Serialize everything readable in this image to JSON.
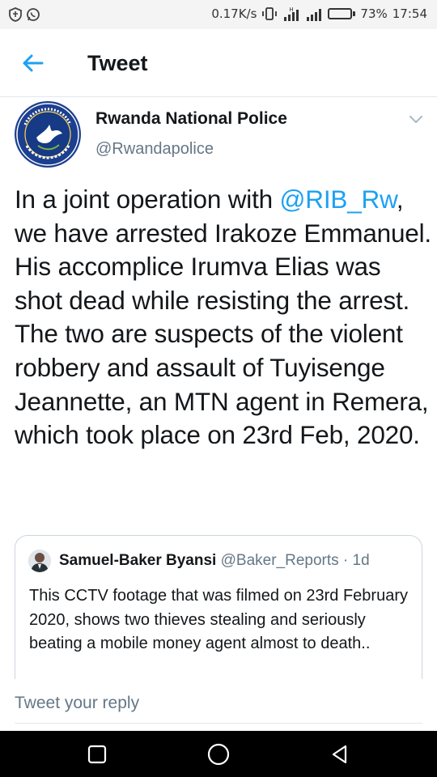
{
  "status_bar": {
    "network_speed": "0.17K/s",
    "battery_percent_text": "73%",
    "battery_level": 0.73,
    "time": "17:54",
    "icons": [
      "shield-icon",
      "whatsapp-icon",
      "vibrate-icon",
      "signal-h-icon",
      "signal-icon",
      "battery-icon"
    ]
  },
  "header": {
    "title": "Tweet",
    "back_icon": "back-arrow-icon"
  },
  "tweet": {
    "author_name": "Rwanda National Police",
    "author_handle": "@Rwandapolice",
    "avatar_icon": "police-logo",
    "menu_icon": "chevron-down-icon",
    "text_before_mention": "In a joint operation with ",
    "mention": "@RIB_Rw",
    "text_after_mention": ", we have arrested Irakoze Emmanuel. His accomplice Irumva Elias was shot dead while resisting the arrest.",
    "text_paragraph_2": "The two are suspects of the violent robbery and assault of Tuyisenge Jeannette, an MTN agent in Remera, which took place on 23rd Feb, 2020."
  },
  "quoted_tweet": {
    "author_name": "Samuel-Baker Byansi",
    "author_handle": "@Baker_Reports",
    "separator": " · ",
    "age": "1d",
    "text": "This CCTV footage that was filmed on 23rd February 2020, shows two thieves stealing and seriously beating a mobile money agent almost to death.."
  },
  "reply": {
    "placeholder": "Tweet your reply"
  },
  "nav_bar": {
    "buttons": [
      "recents-square-icon",
      "home-circle-icon",
      "back-triangle-icon"
    ]
  },
  "colors": {
    "accent": "#1da1f2",
    "text_primary": "#14171a",
    "text_secondary": "#657786",
    "border": "#e1e8ed"
  }
}
